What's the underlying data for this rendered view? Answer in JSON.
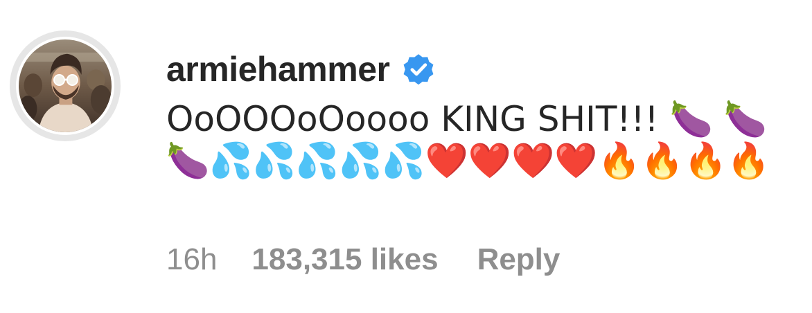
{
  "comment": {
    "username": "armiehammer",
    "verified": true,
    "text": "OoOOOoOoooo KING SHIT!!! 🍆 🍆🍆💦💦💦💦💦❤️❤️❤️❤️🔥🔥🔥🔥",
    "time": "16h",
    "likes": "183,315 likes",
    "reply_label": "Reply"
  },
  "colors": {
    "text": "#262626",
    "meta": "#8e8e8e",
    "verified_badge": "#3897f0",
    "avatar_ring": "#e6e6e6"
  },
  "icons": {
    "verified": "verified-badge-icon",
    "avatar": "profile-photo"
  }
}
